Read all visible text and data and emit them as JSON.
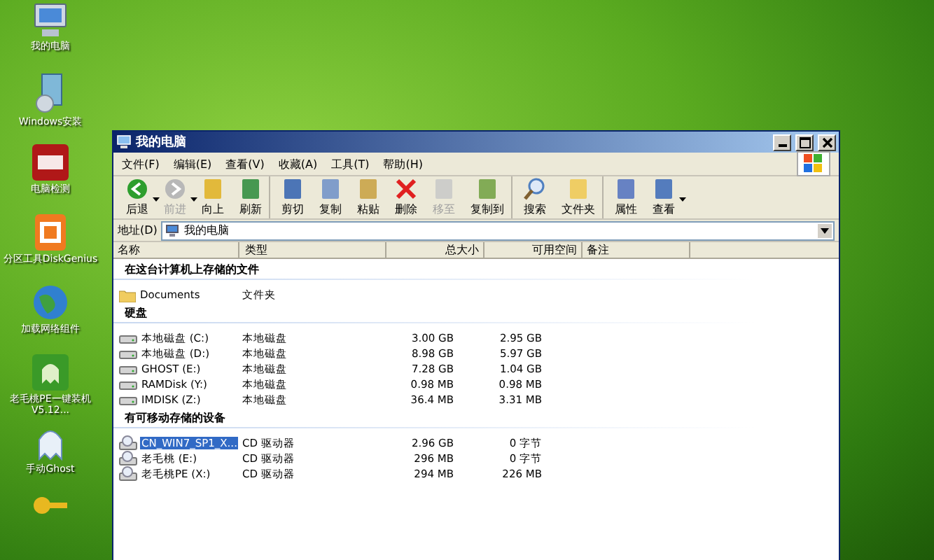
{
  "desktop_icons": [
    {
      "label": "我的电脑",
      "kind": "computer"
    },
    {
      "label": "Windows安装",
      "kind": "installer"
    },
    {
      "label": "电脑检测",
      "kind": "badge64"
    },
    {
      "label": "分区工具DiskGenius",
      "kind": "disk"
    },
    {
      "label": "加载网络组件",
      "kind": "globe"
    },
    {
      "label": "老毛桃PE一键装机 V5.12...",
      "kind": "ghostgreen"
    },
    {
      "label": "手动Ghost",
      "kind": "ghost"
    },
    {
      "kind": "key"
    }
  ],
  "window": {
    "title": "我的电脑",
    "menu": [
      "文件(F)",
      "编辑(E)",
      "查看(V)",
      "收藏(A)",
      "工具(T)",
      "帮助(H)"
    ],
    "toolbar": [
      {
        "label": "后退",
        "kind": "back",
        "disabled": false,
        "dropdown": true,
        "sep": false
      },
      {
        "label": "前进",
        "kind": "forward",
        "disabled": true,
        "dropdown": true,
        "sep": false
      },
      {
        "label": "向上",
        "kind": "up",
        "disabled": false,
        "dropdown": false,
        "sep": false
      },
      {
        "label": "刷新",
        "kind": "refresh",
        "disabled": false,
        "dropdown": false,
        "sep": true
      },
      {
        "label": "剪切",
        "kind": "cut",
        "disabled": false,
        "dropdown": false,
        "sep": false
      },
      {
        "label": "复制",
        "kind": "copy",
        "disabled": false,
        "dropdown": false,
        "sep": false
      },
      {
        "label": "粘贴",
        "kind": "paste",
        "disabled": false,
        "dropdown": false,
        "sep": false
      },
      {
        "label": "删除",
        "kind": "delete",
        "disabled": false,
        "dropdown": false,
        "sep": false
      },
      {
        "label": "移至",
        "kind": "move",
        "disabled": true,
        "dropdown": false,
        "sep": false
      },
      {
        "label": "复制到",
        "kind": "copyto",
        "disabled": false,
        "dropdown": false,
        "sep": true
      },
      {
        "label": "搜索",
        "kind": "search",
        "disabled": false,
        "dropdown": false,
        "sep": false
      },
      {
        "label": "文件夹",
        "kind": "folder",
        "disabled": false,
        "dropdown": false,
        "sep": true
      },
      {
        "label": "属性",
        "kind": "props",
        "disabled": false,
        "dropdown": false,
        "sep": false
      },
      {
        "label": "查看",
        "kind": "view",
        "disabled": false,
        "dropdown": true,
        "sep": false
      }
    ],
    "address": {
      "label": "地址(D)",
      "value": "我的电脑"
    },
    "columns": [
      "名称",
      "类型",
      "总大小",
      "可用空间",
      "备注"
    ],
    "groups": [
      {
        "title": "在这台计算机上存储的文件",
        "rows": [
          {
            "name": "Documents",
            "type": "文件夹",
            "total": "",
            "free": "",
            "kind": "folder",
            "selected": false
          }
        ]
      },
      {
        "title": "硬盘",
        "rows": [
          {
            "name": "本地磁盘 (C:)",
            "type": "本地磁盘",
            "total": "3.00 GB",
            "free": "2.95 GB",
            "kind": "hdd",
            "selected": false
          },
          {
            "name": "本地磁盘 (D:)",
            "type": "本地磁盘",
            "total": "8.98 GB",
            "free": "5.97 GB",
            "kind": "hdd",
            "selected": false
          },
          {
            "name": "GHOST (E:)",
            "type": "本地磁盘",
            "total": "7.28 GB",
            "free": "1.04 GB",
            "kind": "hdd",
            "selected": false
          },
          {
            "name": "RAMDisk (Y:)",
            "type": "本地磁盘",
            "total": "0.98 MB",
            "free": "0.98 MB",
            "kind": "hdd",
            "selected": false
          },
          {
            "name": "IMDISK (Z:)",
            "type": "本地磁盘",
            "total": "36.4 MB",
            "free": "3.31 MB",
            "kind": "hdd",
            "selected": false
          }
        ]
      },
      {
        "title": "有可移动存储的设备",
        "rows": [
          {
            "name": "CN_WIN7_SP1_X...",
            "type": "CD 驱动器",
            "total": "2.96 GB",
            "free": "0 字节",
            "kind": "cd",
            "selected": true
          },
          {
            "name": "老毛桃 (E:)",
            "type": "CD 驱动器",
            "total": "296 MB",
            "free": "0 字节",
            "kind": "cd",
            "selected": false
          },
          {
            "name": "老毛桃PE (X:)",
            "type": "CD 驱动器",
            "total": "294 MB",
            "free": "226 MB",
            "kind": "cd",
            "selected": false
          }
        ]
      }
    ]
  }
}
